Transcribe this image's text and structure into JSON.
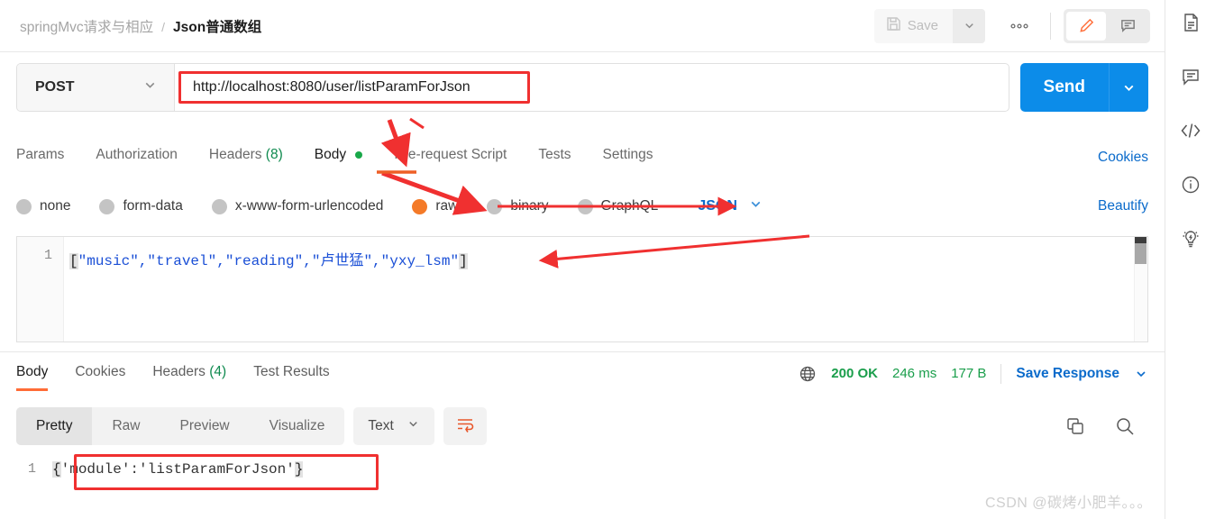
{
  "header": {
    "breadcrumb_parent": "springMvc请求与相应",
    "breadcrumb_separator": "/",
    "breadcrumb_current": "Json普通数组",
    "save_label": "Save",
    "ellipsis_label": "•••"
  },
  "request": {
    "method": "POST",
    "url": "http://localhost:8080/user/listParamForJson",
    "send_label": "Send",
    "tabs": [
      {
        "label": "Params",
        "active": false
      },
      {
        "label": "Authorization",
        "active": false
      },
      {
        "label": "Headers",
        "count": "(8)",
        "active": false
      },
      {
        "label": "Body",
        "active": true,
        "dot": true
      },
      {
        "label": "Pre-request Script",
        "active": false
      },
      {
        "label": "Tests",
        "active": false
      },
      {
        "label": "Settings",
        "active": false
      }
    ],
    "cookies_link": "Cookies",
    "body_types": [
      {
        "label": "none",
        "selected": false
      },
      {
        "label": "form-data",
        "selected": false
      },
      {
        "label": "x-www-form-urlencoded",
        "selected": false
      },
      {
        "label": "raw",
        "selected": true
      },
      {
        "label": "binary",
        "selected": false
      },
      {
        "label": "GraphQL",
        "selected": false
      }
    ],
    "format_label": "JSON",
    "beautify_link": "Beautify",
    "editor": {
      "line_number": "1",
      "open_bracket": "[",
      "content": "\"music\",\"travel\",\"reading\",\"卢世猛\",\"yxy_lsm\"",
      "close_bracket": "]"
    }
  },
  "response": {
    "tabs": [
      {
        "label": "Body",
        "active": true
      },
      {
        "label": "Cookies",
        "active": false
      },
      {
        "label": "Headers",
        "count": "(4)",
        "active": false
      },
      {
        "label": "Test Results",
        "active": false
      }
    ],
    "status_code": "200 OK",
    "time": "246 ms",
    "size": "177 B",
    "save_response_label": "Save Response",
    "view_modes": [
      {
        "label": "Pretty",
        "active": true
      },
      {
        "label": "Raw",
        "active": false
      },
      {
        "label": "Preview",
        "active": false
      },
      {
        "label": "Visualize",
        "active": false
      }
    ],
    "format_label": "Text",
    "body": {
      "line_number": "1",
      "open_brace": "{",
      "content": "'module':'listParamForJson'",
      "close_brace": "}"
    }
  },
  "watermark": "CSDN @碳烤小肥羊。。。",
  "colors": {
    "accent_orange": "#ff6c37",
    "send_blue": "#0c8ce9",
    "link_blue": "#0b6bcb",
    "status_green": "#1a9e4b",
    "annotation_red": "#f03030"
  }
}
